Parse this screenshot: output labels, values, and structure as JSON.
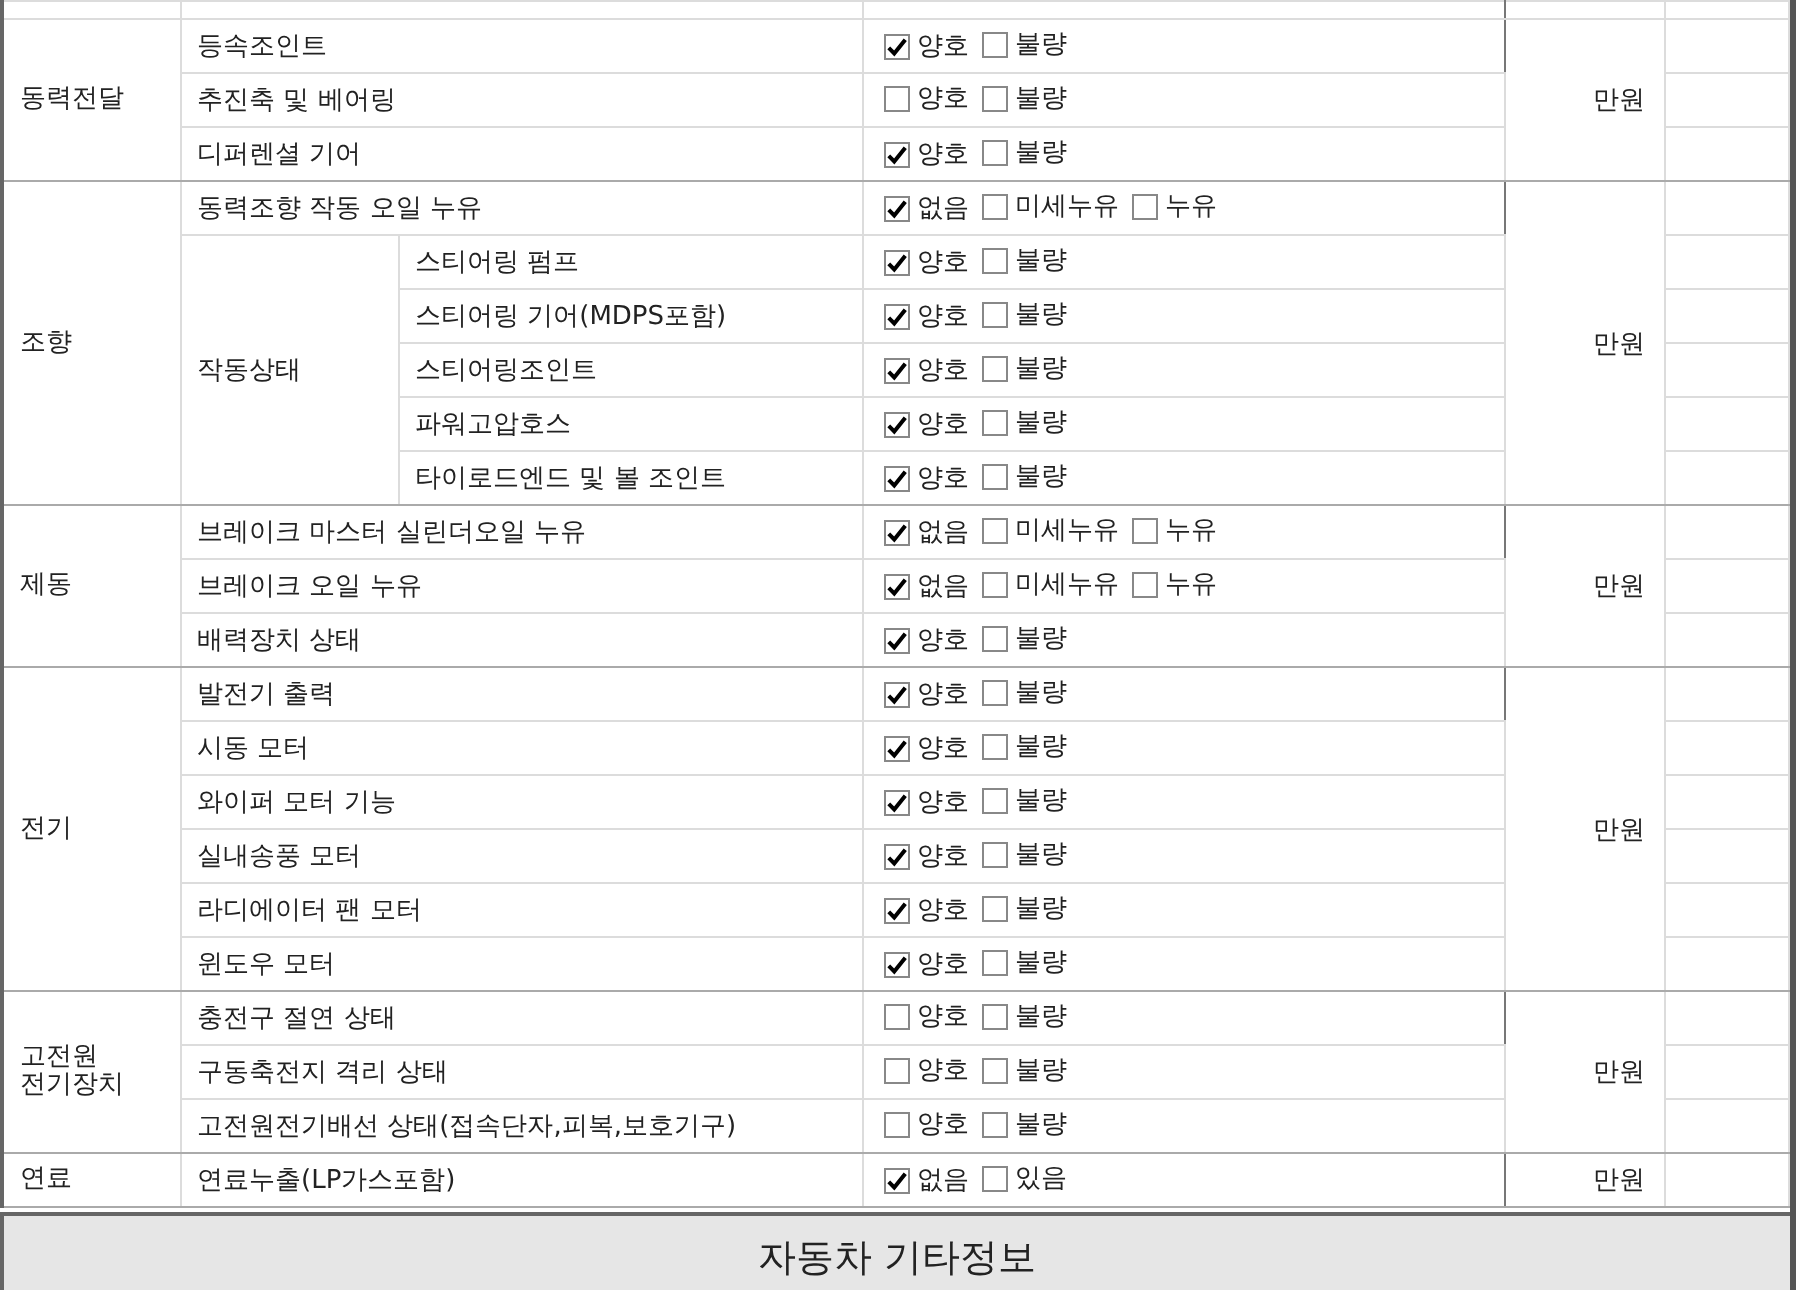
{
  "groups": [
    {
      "name": "동력전달",
      "price_unit": "만원",
      "items": [
        {
          "name": "등속조인트",
          "options": [
            {
              "label": "양호",
              "checked": true
            },
            {
              "label": "불량",
              "checked": false
            }
          ]
        },
        {
          "name": "추진축 및 베어링",
          "options": [
            {
              "label": "양호",
              "checked": false
            },
            {
              "label": "불량",
              "checked": false
            }
          ]
        },
        {
          "name": "디퍼렌셜 기어",
          "options": [
            {
              "label": "양호",
              "checked": true
            },
            {
              "label": "불량",
              "checked": false
            }
          ]
        }
      ]
    },
    {
      "name": "조향",
      "price_unit": "만원",
      "items": [
        {
          "name": "동력조향 작동 오일 누유",
          "options": [
            {
              "label": "없음",
              "checked": true
            },
            {
              "label": "미세누유",
              "checked": false
            },
            {
              "label": "누유",
              "checked": false
            }
          ]
        },
        {
          "name": "작동상태",
          "children": [
            {
              "name": "스티어링 펌프",
              "options": [
                {
                  "label": "양호",
                  "checked": true
                },
                {
                  "label": "불량",
                  "checked": false
                }
              ]
            },
            {
              "name": "스티어링 기어(MDPS포함)",
              "options": [
                {
                  "label": "양호",
                  "checked": true
                },
                {
                  "label": "불량",
                  "checked": false
                }
              ]
            },
            {
              "name": "스티어링조인트",
              "options": [
                {
                  "label": "양호",
                  "checked": true
                },
                {
                  "label": "불량",
                  "checked": false
                }
              ]
            },
            {
              "name": "파워고압호스",
              "options": [
                {
                  "label": "양호",
                  "checked": true
                },
                {
                  "label": "불량",
                  "checked": false
                }
              ]
            },
            {
              "name": "타이로드엔드 및 볼 조인트",
              "options": [
                {
                  "label": "양호",
                  "checked": true
                },
                {
                  "label": "불량",
                  "checked": false
                }
              ]
            }
          ]
        }
      ]
    },
    {
      "name": "제동",
      "price_unit": "만원",
      "items": [
        {
          "name": "브레이크 마스터 실린더오일 누유",
          "options": [
            {
              "label": "없음",
              "checked": true
            },
            {
              "label": "미세누유",
              "checked": false
            },
            {
              "label": "누유",
              "checked": false
            }
          ]
        },
        {
          "name": "브레이크 오일 누유",
          "options": [
            {
              "label": "없음",
              "checked": true
            },
            {
              "label": "미세누유",
              "checked": false
            },
            {
              "label": "누유",
              "checked": false
            }
          ]
        },
        {
          "name": "배력장치 상태",
          "options": [
            {
              "label": "양호",
              "checked": true
            },
            {
              "label": "불량",
              "checked": false
            }
          ]
        }
      ]
    },
    {
      "name": "전기",
      "price_unit": "만원",
      "items": [
        {
          "name": "발전기 출력",
          "options": [
            {
              "label": "양호",
              "checked": true
            },
            {
              "label": "불량",
              "checked": false
            }
          ]
        },
        {
          "name": "시동 모터",
          "options": [
            {
              "label": "양호",
              "checked": true
            },
            {
              "label": "불량",
              "checked": false
            }
          ]
        },
        {
          "name": "와이퍼 모터 기능",
          "options": [
            {
              "label": "양호",
              "checked": true
            },
            {
              "label": "불량",
              "checked": false
            }
          ]
        },
        {
          "name": "실내송풍 모터",
          "options": [
            {
              "label": "양호",
              "checked": true
            },
            {
              "label": "불량",
              "checked": false
            }
          ]
        },
        {
          "name": "라디에이터 팬 모터",
          "options": [
            {
              "label": "양호",
              "checked": true
            },
            {
              "label": "불량",
              "checked": false
            }
          ]
        },
        {
          "name": "윈도우 모터",
          "options": [
            {
              "label": "양호",
              "checked": true
            },
            {
              "label": "불량",
              "checked": false
            }
          ]
        }
      ]
    },
    {
      "name": "고전원\n전기장치",
      "price_unit": "만원",
      "items": [
        {
          "name": "충전구 절연 상태",
          "options": [
            {
              "label": "양호",
              "checked": false
            },
            {
              "label": "불량",
              "checked": false
            }
          ]
        },
        {
          "name": "구동축전지 격리 상태",
          "options": [
            {
              "label": "양호",
              "checked": false
            },
            {
              "label": "불량",
              "checked": false
            }
          ]
        },
        {
          "name": "고전원전기배선 상태(접속단자,피복,보호기구)",
          "options": [
            {
              "label": "양호",
              "checked": false
            },
            {
              "label": "불량",
              "checked": false
            }
          ]
        }
      ]
    },
    {
      "name": "연료",
      "price_unit": "만원",
      "items": [
        {
          "name": "연료누출(LP가스포함)",
          "options": [
            {
              "label": "없음",
              "checked": true
            },
            {
              "label": "있음",
              "checked": false
            }
          ]
        }
      ]
    }
  ],
  "section_header": "자동차 기타정보"
}
